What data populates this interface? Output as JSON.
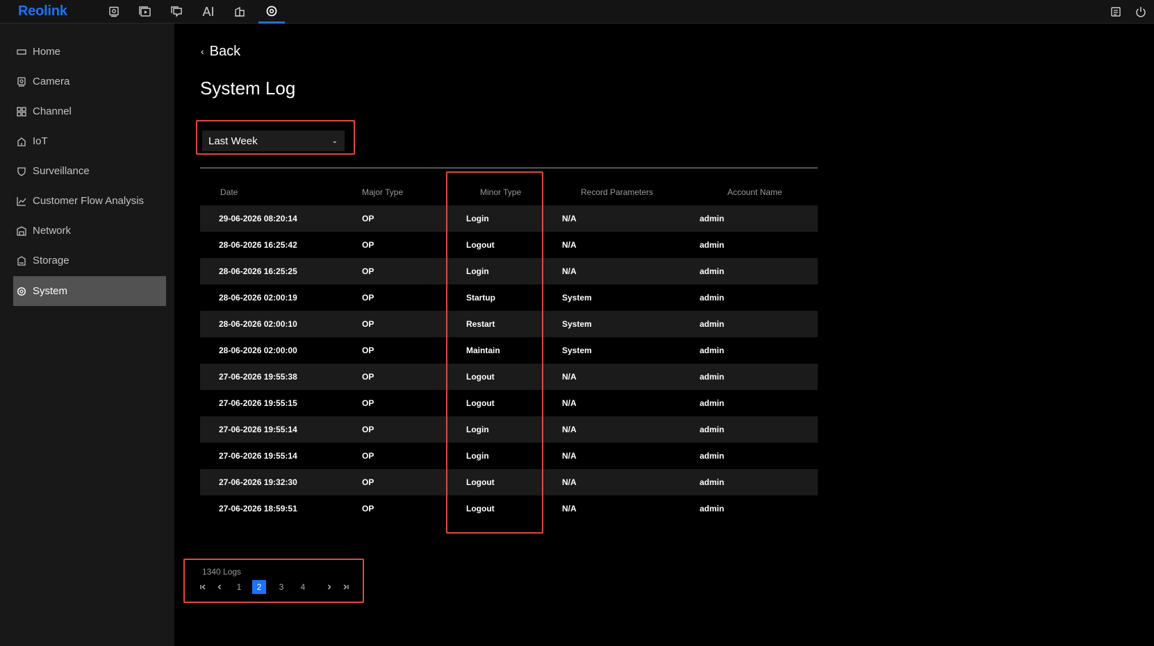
{
  "app": {
    "logo": "Reolink",
    "ai_label": "AI"
  },
  "colors": {
    "accent": "#1a73ff",
    "highlight_box": "#e5483f",
    "background": "#000000",
    "sidebar_active": "#525252"
  },
  "topnav": [
    {
      "name": "live-view-icon"
    },
    {
      "name": "playback-icon"
    },
    {
      "name": "messages-icon"
    },
    {
      "name": "ai-label"
    },
    {
      "name": "devices-icon"
    },
    {
      "name": "settings-icon",
      "active": true
    }
  ],
  "topright": [
    {
      "name": "notes-icon"
    },
    {
      "name": "power-icon"
    }
  ],
  "sidebar": {
    "items": [
      {
        "label": "Home",
        "icon": "home-icon"
      },
      {
        "label": "Camera",
        "icon": "camera-icon"
      },
      {
        "label": "Channel",
        "icon": "grid-icon"
      },
      {
        "label": "IoT",
        "icon": "iot-icon"
      },
      {
        "label": "Surveillance",
        "icon": "shield-icon"
      },
      {
        "label": "Customer Flow Analysis",
        "icon": "chart-line-icon"
      },
      {
        "label": "Network",
        "icon": "network-icon"
      },
      {
        "label": "Storage",
        "icon": "storage-icon"
      },
      {
        "label": "System",
        "icon": "gear-icon",
        "active": true
      }
    ]
  },
  "main": {
    "back_label": "Back",
    "title": "System Log",
    "filter": {
      "selected": "Last Week"
    },
    "table": {
      "headers": [
        "Date",
        "Major Type",
        "Minor Type",
        "Record Parameters",
        "Account Name"
      ],
      "rows": [
        [
          "29-06-2026 08:20:14",
          "OP",
          "Login",
          "N/A",
          "admin"
        ],
        [
          "28-06-2026 16:25:42",
          "OP",
          "Logout",
          "N/A",
          "admin"
        ],
        [
          "28-06-2026 16:25:25",
          "OP",
          "Login",
          "N/A",
          "admin"
        ],
        [
          "28-06-2026 02:00:19",
          "OP",
          "Startup",
          "System",
          "admin"
        ],
        [
          "28-06-2026 02:00:10",
          "OP",
          "Restart",
          "System",
          "admin"
        ],
        [
          "28-06-2026 02:00:00",
          "OP",
          "Maintain",
          "System",
          "admin"
        ],
        [
          "27-06-2026 19:55:38",
          "OP",
          "Logout",
          "N/A",
          "admin"
        ],
        [
          "27-06-2026 19:55:15",
          "OP",
          "Logout",
          "N/A",
          "admin"
        ],
        [
          "27-06-2026 19:55:14",
          "OP",
          "Login",
          "N/A",
          "admin"
        ],
        [
          "27-06-2026 19:55:14",
          "OP",
          "Login",
          "N/A",
          "admin"
        ],
        [
          "27-06-2026 19:32:30",
          "OP",
          "Logout",
          "N/A",
          "admin"
        ],
        [
          "27-06-2026 18:59:51",
          "OP",
          "Logout",
          "N/A",
          "admin"
        ]
      ]
    },
    "pagination": {
      "count_label": "1340 Logs",
      "pages": [
        "1",
        "2",
        "3",
        "4"
      ],
      "current": "2"
    }
  }
}
